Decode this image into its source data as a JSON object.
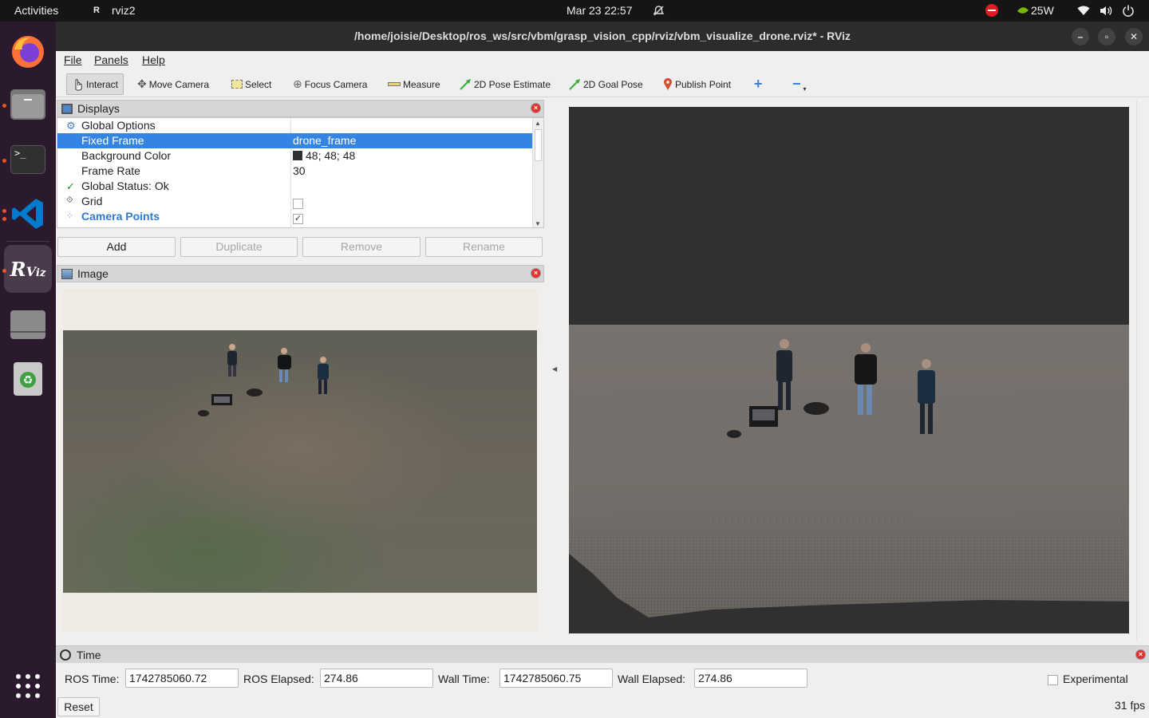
{
  "topbar": {
    "activities": "Activities",
    "app_name": "rviz2",
    "clock": "Mar 23  22:57",
    "gpu_power": "25W"
  },
  "window": {
    "title": "/home/joisie/Desktop/ros_ws/src/vbm/grasp_vision_cpp/rviz/vbm_visualize_drone.rviz* - RViz"
  },
  "menu": {
    "file": "File",
    "panels": "Panels",
    "help": "Help"
  },
  "toolbar": {
    "interact": "Interact",
    "move_camera": "Move Camera",
    "select": "Select",
    "focus_camera": "Focus Camera",
    "measure": "Measure",
    "pose_estimate": "2D Pose Estimate",
    "goal_pose": "2D Goal Pose",
    "publish_point": "Publish Point"
  },
  "displays": {
    "title": "Displays",
    "rows": [
      {
        "label": "Global Options",
        "value": ""
      },
      {
        "label": "Fixed Frame",
        "value": "drone_frame"
      },
      {
        "label": "Background Color",
        "value": "48; 48; 48"
      },
      {
        "label": "Frame Rate",
        "value": "30"
      },
      {
        "label": "Global Status: Ok",
        "value": ""
      },
      {
        "label": "Grid",
        "value": ""
      },
      {
        "label": "Camera Points",
        "value": ""
      }
    ],
    "background_color_hex": "#303030",
    "grid_checked": false,
    "camera_points_checked": true,
    "add": "Add",
    "duplicate": "Duplicate",
    "remove": "Remove",
    "rename": "Rename"
  },
  "image_panel": {
    "title": "Image"
  },
  "time_panel": {
    "title": "Time",
    "ros_time_label": "ROS Time:",
    "ros_time": "1742785060.72",
    "ros_elapsed_label": "ROS Elapsed:",
    "ros_elapsed": "274.86",
    "wall_time_label": "Wall Time:",
    "wall_time": "1742785060.75",
    "wall_elapsed_label": "Wall Elapsed:",
    "wall_elapsed": "274.86",
    "experimental": "Experimental",
    "reset": "Reset",
    "fps": "31 fps"
  },
  "colors": {
    "selection": "#3584e4",
    "dock": "#2b1a2d",
    "accent": "#e95420"
  }
}
